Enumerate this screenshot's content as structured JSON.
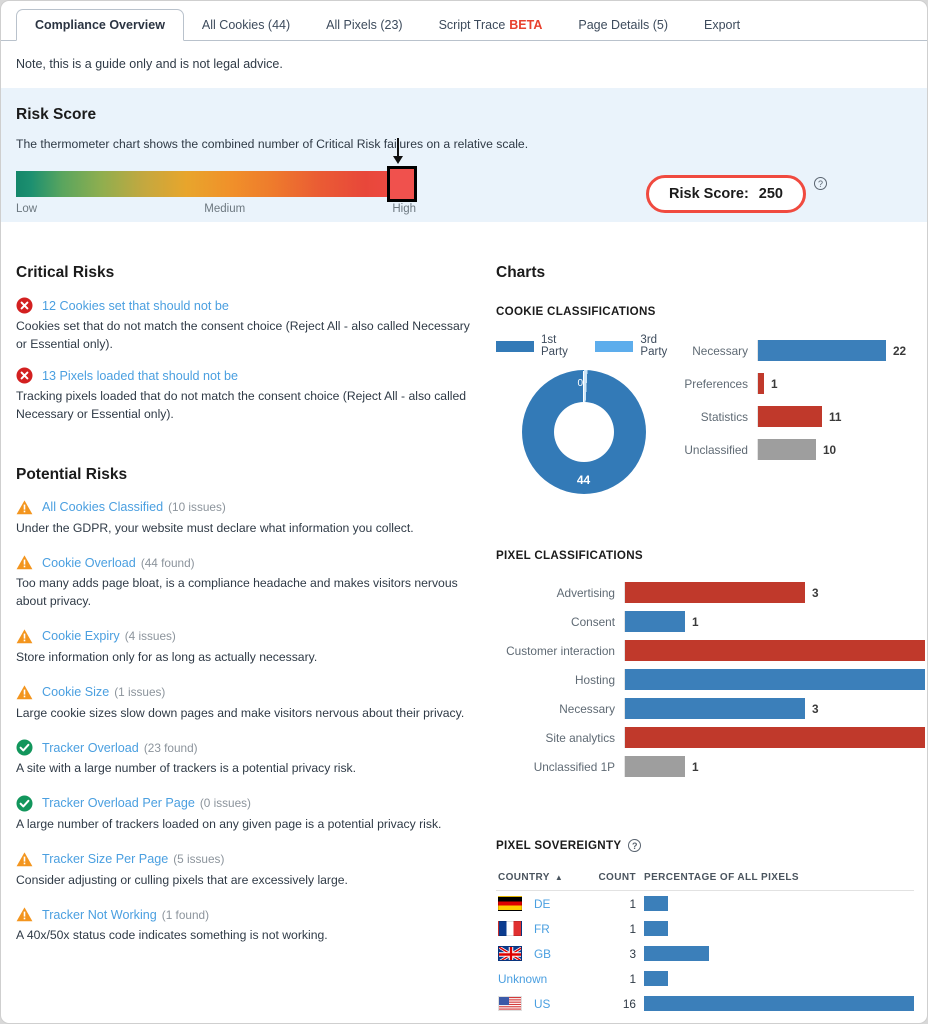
{
  "tabs": [
    {
      "label": "Compliance Overview",
      "active": true,
      "beta": ""
    },
    {
      "label": "All Cookies (44)",
      "active": false,
      "beta": ""
    },
    {
      "label": "All Pixels (23)",
      "active": false,
      "beta": ""
    },
    {
      "label": "Script Trace",
      "active": false,
      "beta": "BETA"
    },
    {
      "label": "Page Details (5)",
      "active": false,
      "beta": ""
    },
    {
      "label": "Export",
      "active": false,
      "beta": ""
    }
  ],
  "note": "Note, this is a guide only and is not legal advice.",
  "risk_score": {
    "heading": "Risk Score",
    "description": "The thermometer chart shows the combined number of Critical Risk failures on a relative scale.",
    "scale_low": "Low",
    "scale_medium": "Medium",
    "scale_high": "High",
    "pill_label": "Risk Score:",
    "pill_value": "250",
    "help_glyph": "?",
    "marker_position_pct": 95,
    "accent_red": "#f04a3f",
    "band_bg": "#eaf3fb"
  },
  "critical_risks": {
    "heading": "Critical Risks",
    "items": [
      {
        "icon": "error-circle-icon",
        "title": "12 Cookies set that should not be",
        "count": "",
        "text": "Cookies set that do not match the consent choice (Reject All - also called Necessary or Essential only)."
      },
      {
        "icon": "error-circle-icon",
        "title": "13 Pixels loaded that should not be",
        "count": "",
        "text": "Tracking pixels loaded that do not match the consent choice (Reject All - also called Necessary or Essential only)."
      }
    ]
  },
  "potential_risks": {
    "heading": "Potential Risks",
    "items": [
      {
        "icon": "warning-triangle-icon",
        "title": "All Cookies Classified",
        "count": "(10 issues)",
        "text": "Under the GDPR, your website must declare what information you collect."
      },
      {
        "icon": "warning-triangle-icon",
        "title": "Cookie Overload",
        "count": "(44 found)",
        "text": "Too many adds page bloat, is a compliance headache and makes visitors nervous about privacy."
      },
      {
        "icon": "warning-triangle-icon",
        "title": "Cookie Expiry",
        "count": "(4 issues)",
        "text": "Store information only for as long as actually necessary."
      },
      {
        "icon": "warning-triangle-icon",
        "title": "Cookie Size",
        "count": "(1 issues)",
        "text": "Large cookie sizes slow down pages and make visitors nervous about their privacy."
      },
      {
        "icon": "check-circle-icon",
        "title": "Tracker Overload",
        "count": "(23 found)",
        "text": "A site with a large number of trackers is a potential privacy risk."
      },
      {
        "icon": "check-circle-icon",
        "title": "Tracker Overload Per Page",
        "count": "(0 issues)",
        "text": "A large number of trackers loaded on any given page is a potential privacy risk."
      },
      {
        "icon": "warning-triangle-icon",
        "title": "Tracker Size Per Page",
        "count": "(5 issues)",
        "text": "Consider adjusting or culling pixels that are excessively large."
      },
      {
        "icon": "warning-triangle-icon",
        "title": "Tracker Not Working",
        "count": "(1 found)",
        "text": "A 40x/50x status code indicates something is not working."
      }
    ]
  },
  "charts_heading": "Charts",
  "chart_data": [
    {
      "type": "pie",
      "title": "COOKIE CLASSIFICATIONS",
      "subchart": "donut",
      "categories": [
        "1st Party",
        "3rd Party"
      ],
      "values": [
        44,
        0
      ],
      "colors": [
        "#337ab7",
        "#5dadec"
      ],
      "legend": [
        "1st Party",
        "3rd Party"
      ],
      "legend_position": "top",
      "labels": [
        "44",
        "0"
      ]
    },
    {
      "type": "bar",
      "orientation": "horizontal",
      "title": "COOKIE CLASSIFICATIONS",
      "categories": [
        "Necessary",
        "Preferences",
        "Statistics",
        "Unclassified"
      ],
      "values": [
        22,
        1,
        11,
        10
      ],
      "colors": [
        "#3b7fba",
        "#c0392b",
        "#c0392b",
        "#9e9e9e"
      ],
      "xlim": [
        0,
        22
      ],
      "grid": false
    },
    {
      "type": "bar",
      "orientation": "horizontal",
      "title": "PIXEL CLASSIFICATIONS",
      "categories": [
        "Advertising",
        "Consent",
        "Customer interaction",
        "Hosting",
        "Necessary",
        "Site analytics",
        "Unclassified 1P"
      ],
      "values": [
        3,
        1,
        5,
        5,
        3,
        5,
        1
      ],
      "colors": [
        "#c0392b",
        "#3b7fba",
        "#c0392b",
        "#3b7fba",
        "#3b7fba",
        "#c0392b",
        "#9e9e9e"
      ],
      "xlim": [
        0,
        5
      ],
      "grid": false
    },
    {
      "type": "table",
      "title": "PIXEL SOVEREIGNTY",
      "help_glyph": "?",
      "columns": [
        "COUNTRY",
        "COUNT",
        "PERCENTAGE OF ALL PIXELS"
      ],
      "sort_column": "COUNTRY",
      "sort_dir": "asc",
      "sort_caret": "▲",
      "rows": [
        {
          "flag": "de-flag-icon",
          "country": "DE",
          "count": "1",
          "pct_of_max": 9
        },
        {
          "flag": "fr-flag-icon",
          "country": "FR",
          "count": "1",
          "pct_of_max": 9
        },
        {
          "flag": "gb-flag-icon",
          "country": "GB",
          "count": "3",
          "pct_of_max": 24
        },
        {
          "flag": "none",
          "country": "Unknown",
          "count": "1",
          "pct_of_max": 9
        },
        {
          "flag": "us-flag-icon",
          "country": "US",
          "count": "16",
          "pct_of_max": 100
        }
      ],
      "bar_color": "#3b7fba"
    }
  ]
}
